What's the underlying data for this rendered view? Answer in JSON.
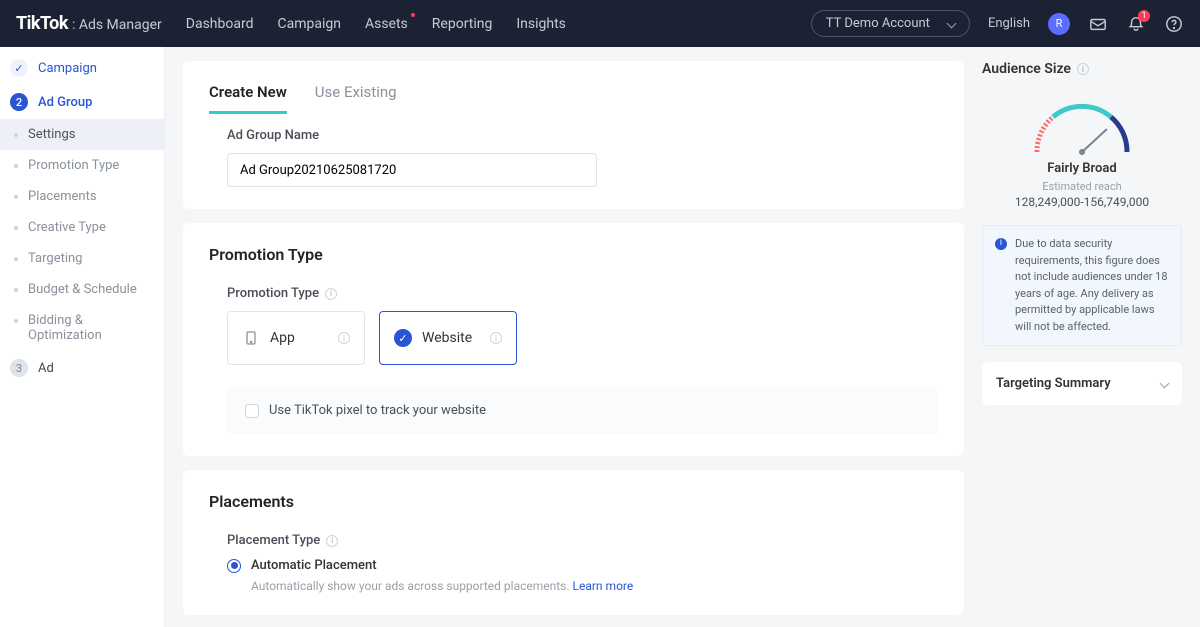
{
  "header": {
    "brand": "TikTok",
    "brandSub": ": Ads Manager",
    "nav": {
      "dashboard": "Dashboard",
      "campaign": "Campaign",
      "assets": "Assets",
      "reporting": "Reporting",
      "insights": "Insights"
    },
    "account_label": "TT Demo Account",
    "language": "English",
    "avatar_initial": "R",
    "bell_count": "1"
  },
  "sidebar": {
    "steps": {
      "campaign": "Campaign",
      "adgroup": "Ad Group",
      "adgroup_num": "2",
      "ad": "Ad",
      "ad_num": "3"
    },
    "subs": {
      "settings": "Settings",
      "promotion_type": "Promotion Type",
      "placements": "Placements",
      "creative_type": "Creative Type",
      "targeting": "Targeting",
      "budget_schedule": "Budget & Schedule",
      "bidding_optimization": "Bidding & Optimization"
    }
  },
  "tabs": {
    "create_new": "Create New",
    "use_existing": "Use Existing"
  },
  "adgroup": {
    "name_label": "Ad Group Name",
    "name_value": "Ad Group20210625081720"
  },
  "promotion": {
    "section_title": "Promotion Type",
    "label": "Promotion Type",
    "option_app": "App",
    "option_website": "Website",
    "pixel_text": "Use TikTok pixel to track your website"
  },
  "placements": {
    "section_title": "Placements",
    "type_label": "Placement Type",
    "auto_label": "Automatic Placement",
    "auto_desc": "Automatically show your ads across supported placements. ",
    "learn_more": "Learn more"
  },
  "audience": {
    "title": "Audience Size",
    "size_label": "Fairly Broad",
    "est_label": "Estimated reach",
    "range": "128,249,000-156,749,000",
    "note": "Due to data security requirements, this figure does not include audiences under 18 years of age. Any delivery as permitted by applicable laws will not be affected."
  },
  "targeting_summary": {
    "title": "Targeting Summary"
  }
}
